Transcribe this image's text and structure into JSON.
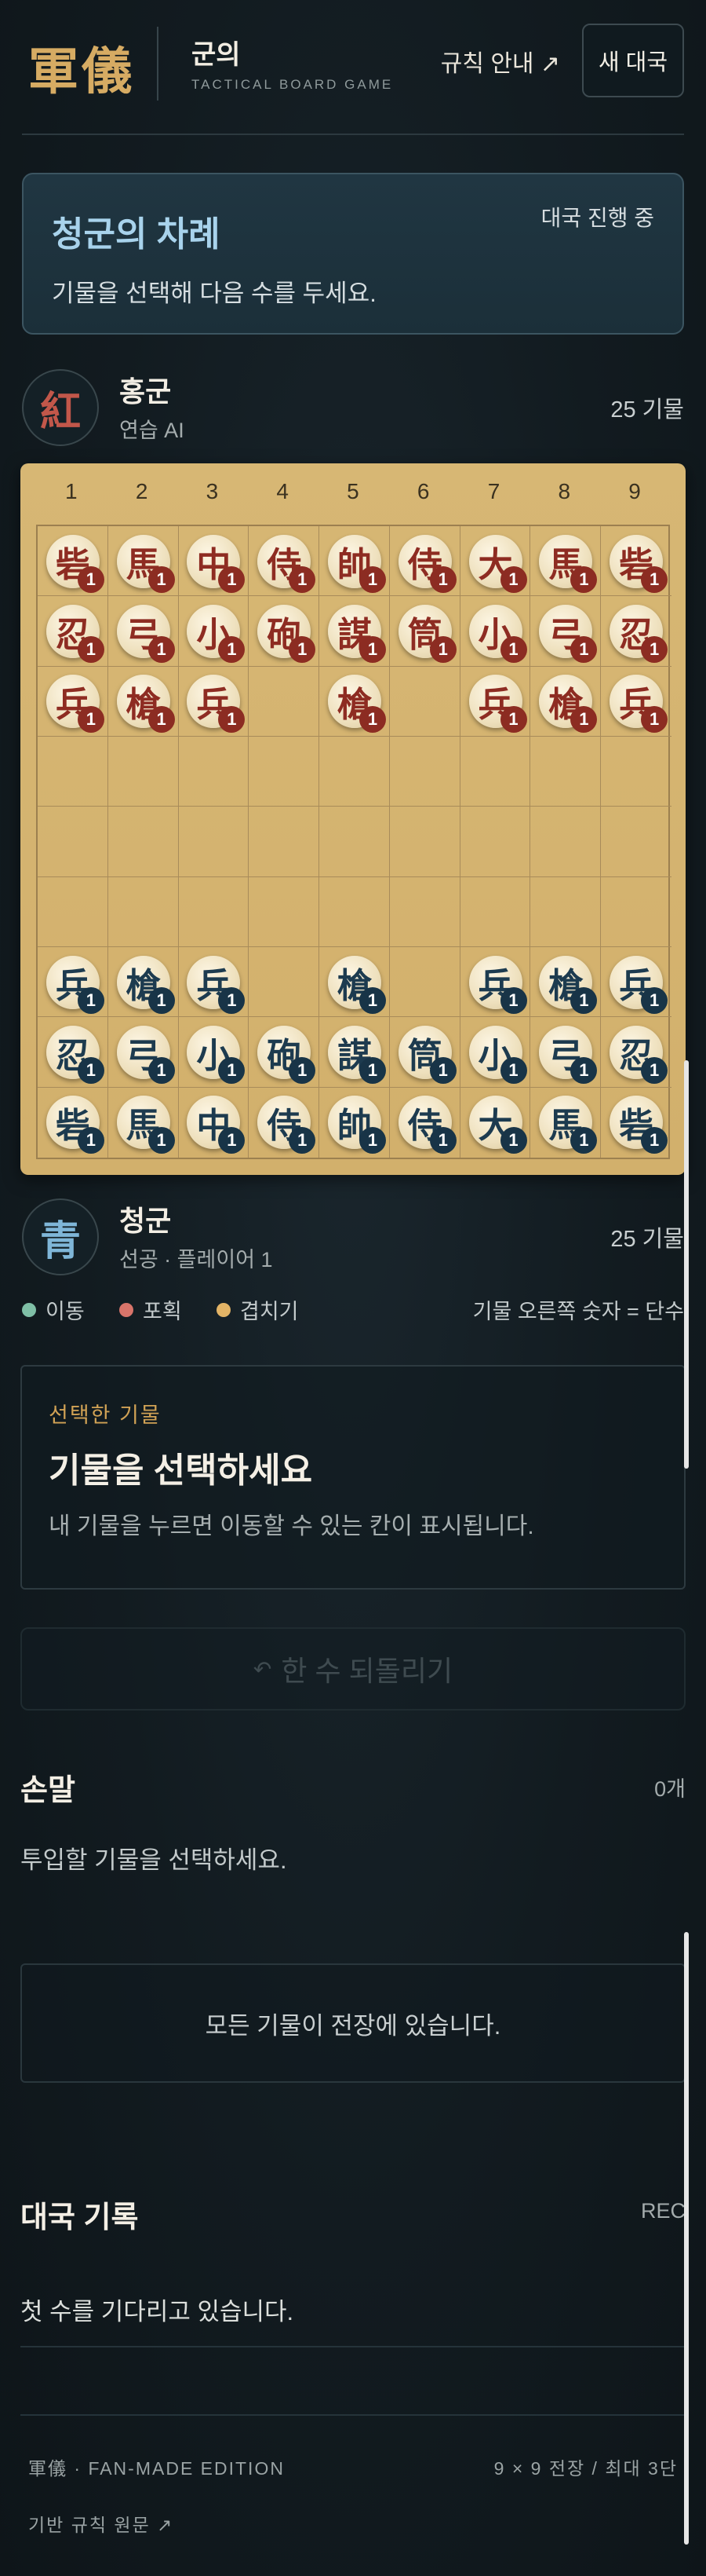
{
  "header": {
    "logo": "軍儀",
    "title": "군의",
    "subtitle": "TACTICAL BOARD GAME",
    "rules_link": "규칙 안내 ↗",
    "new_game": "새 대국"
  },
  "turn": {
    "title": "청군의 차례",
    "status": "대국 진행 중",
    "description": "기물을 선택해 다음 수를 두세요."
  },
  "red_player": {
    "emblem": "紅",
    "name": "홍군",
    "role": "연습 AI",
    "count": "25 기물",
    "color": "#c2574a"
  },
  "blue_player": {
    "emblem": "青",
    "name": "청군",
    "role": "선공 · 플레이어 1",
    "count": "25 기물",
    "color": "#7fb6d8"
  },
  "board": {
    "columns": [
      "1",
      "2",
      "3",
      "4",
      "5",
      "6",
      "7",
      "8",
      "9"
    ],
    "rows": [
      [
        {
          "side": "red",
          "char": "砦",
          "n": "1"
        },
        {
          "side": "red",
          "char": "馬",
          "n": "1"
        },
        {
          "side": "red",
          "char": "中",
          "n": "1"
        },
        {
          "side": "red",
          "char": "侍",
          "n": "1"
        },
        {
          "side": "red",
          "char": "帥",
          "n": "1"
        },
        {
          "side": "red",
          "char": "侍",
          "n": "1"
        },
        {
          "side": "red",
          "char": "大",
          "n": "1"
        },
        {
          "side": "red",
          "char": "馬",
          "n": "1"
        },
        {
          "side": "red",
          "char": "砦",
          "n": "1"
        }
      ],
      [
        {
          "side": "red",
          "char": "忍",
          "n": "1"
        },
        {
          "side": "red",
          "char": "弓",
          "n": "1"
        },
        {
          "side": "red",
          "char": "小",
          "n": "1"
        },
        {
          "side": "red",
          "char": "砲",
          "n": "1"
        },
        {
          "side": "red",
          "char": "謀",
          "n": "1"
        },
        {
          "side": "red",
          "char": "筒",
          "n": "1"
        },
        {
          "side": "red",
          "char": "小",
          "n": "1"
        },
        {
          "side": "red",
          "char": "弓",
          "n": "1"
        },
        {
          "side": "red",
          "char": "忍",
          "n": "1"
        }
      ],
      [
        {
          "side": "red",
          "char": "兵",
          "n": "1"
        },
        {
          "side": "red",
          "char": "槍",
          "n": "1"
        },
        {
          "side": "red",
          "char": "兵",
          "n": "1"
        },
        null,
        {
          "side": "red",
          "char": "槍",
          "n": "1"
        },
        null,
        {
          "side": "red",
          "char": "兵",
          "n": "1"
        },
        {
          "side": "red",
          "char": "槍",
          "n": "1"
        },
        {
          "side": "red",
          "char": "兵",
          "n": "1"
        }
      ],
      [
        null,
        null,
        null,
        null,
        null,
        null,
        null,
        null,
        null
      ],
      [
        null,
        null,
        null,
        null,
        null,
        null,
        null,
        null,
        null
      ],
      [
        null,
        null,
        null,
        null,
        null,
        null,
        null,
        null,
        null
      ],
      [
        {
          "side": "blue",
          "char": "兵",
          "n": "1"
        },
        {
          "side": "blue",
          "char": "槍",
          "n": "1"
        },
        {
          "side": "blue",
          "char": "兵",
          "n": "1"
        },
        null,
        {
          "side": "blue",
          "char": "槍",
          "n": "1"
        },
        null,
        {
          "side": "blue",
          "char": "兵",
          "n": "1"
        },
        {
          "side": "blue",
          "char": "槍",
          "n": "1"
        },
        {
          "side": "blue",
          "char": "兵",
          "n": "1"
        }
      ],
      [
        {
          "side": "blue",
          "char": "忍",
          "n": "1"
        },
        {
          "side": "blue",
          "char": "弓",
          "n": "1"
        },
        {
          "side": "blue",
          "char": "小",
          "n": "1"
        },
        {
          "side": "blue",
          "char": "砲",
          "n": "1"
        },
        {
          "side": "blue",
          "char": "謀",
          "n": "1"
        },
        {
          "side": "blue",
          "char": "筒",
          "n": "1"
        },
        {
          "side": "blue",
          "char": "小",
          "n": "1"
        },
        {
          "side": "blue",
          "char": "弓",
          "n": "1"
        },
        {
          "side": "blue",
          "char": "忍",
          "n": "1"
        }
      ],
      [
        {
          "side": "blue",
          "char": "砦",
          "n": "1"
        },
        {
          "side": "blue",
          "char": "馬",
          "n": "1"
        },
        {
          "side": "blue",
          "char": "中",
          "n": "1"
        },
        {
          "side": "blue",
          "char": "侍",
          "n": "1"
        },
        {
          "side": "blue",
          "char": "帥",
          "n": "1"
        },
        {
          "side": "blue",
          "char": "侍",
          "n": "1"
        },
        {
          "side": "blue",
          "char": "大",
          "n": "1"
        },
        {
          "side": "blue",
          "char": "馬",
          "n": "1"
        },
        {
          "side": "blue",
          "char": "砦",
          "n": "1"
        }
      ]
    ]
  },
  "legend": {
    "items": [
      {
        "label": "이동",
        "color": "#7fbfa6"
      },
      {
        "label": "포획",
        "color": "#d8746a"
      },
      {
        "label": "겹치기",
        "color": "#e3b466"
      }
    ],
    "note": "기물 오른쪽 숫자 = 단수"
  },
  "selected": {
    "label": "선택한 기물",
    "title": "기물을 선택하세요",
    "description": "내 기물을 누르면 이동할 수 있는 칸이 표시됩니다."
  },
  "undo": {
    "icon": "undo-icon",
    "label": "한 수 되돌리기"
  },
  "hand": {
    "title": "손말",
    "count": "0개",
    "description": "투입할 기물을 선택하세요.",
    "empty": "모든 기물이 전장에 있습니다."
  },
  "log": {
    "title": "대국 기록",
    "tag": "REC",
    "empty": "첫 수를 기다리고 있습니다."
  },
  "footer": {
    "edition": "軍儀 · FAN-MADE EDITION",
    "meta": "9 × 9 전장   /   최대 3단",
    "link": "기반 규칙 원문 ↗"
  }
}
